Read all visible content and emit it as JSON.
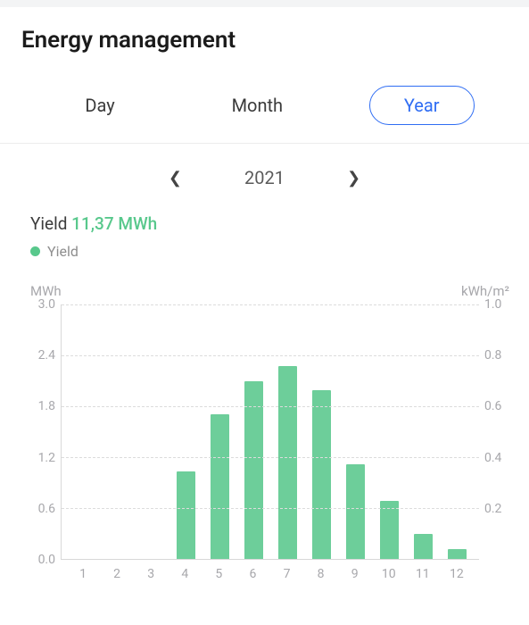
{
  "header": {
    "title": "Energy management"
  },
  "tabs": {
    "day": "Day",
    "month": "Month",
    "year": "Year",
    "active": "year"
  },
  "nav": {
    "year": "2021"
  },
  "summary": {
    "yield_label": "Yield",
    "yield_value": "11,37 MWh",
    "legend_label": "Yield"
  },
  "chart_data": {
    "type": "bar",
    "categories": [
      "1",
      "2",
      "3",
      "4",
      "5",
      "6",
      "7",
      "8",
      "9",
      "10",
      "11",
      "12"
    ],
    "values": [
      0,
      0,
      0,
      1.03,
      1.71,
      2.1,
      2.27,
      1.99,
      1.12,
      0.68,
      0.3,
      0.12
    ],
    "title": "",
    "left_unit": "MWh",
    "right_unit": "kWh/m²",
    "left_ticks": [
      "0.0",
      "0.6",
      "1.2",
      "1.8",
      "2.4",
      "3.0"
    ],
    "right_ticks": [
      "",
      "0.2",
      "0.4",
      "0.6",
      "0.8",
      "1.0"
    ],
    "ylim": [
      0,
      3.0
    ]
  }
}
